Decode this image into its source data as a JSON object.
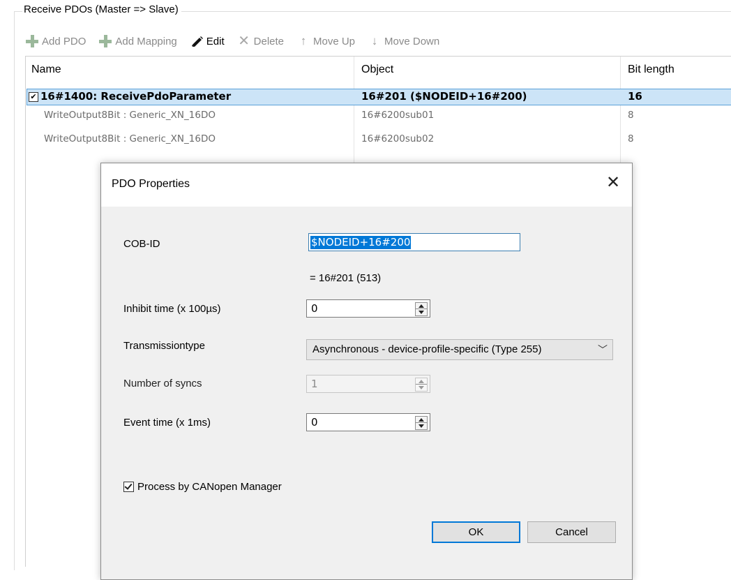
{
  "group": {
    "title": "Receive PDOs (Master => Slave)"
  },
  "toolbar": {
    "add_pdo": "Add PDO",
    "add_mapping": "Add Mapping",
    "edit": "Edit",
    "delete": "Delete",
    "move_up": "Move Up",
    "move_down": "Move Down"
  },
  "table": {
    "columns": [
      "Name",
      "Object",
      "Bit length"
    ],
    "rows": [
      {
        "checked": true,
        "name": "16#1400: ReceivePdoParameter",
        "object": "16#201 ($NODEID+16#200)",
        "bit_length": "16"
      },
      {
        "name": "WriteOutput8Bit : Generic_XN_16DO",
        "object": "16#6200sub01",
        "bit_length": "8"
      },
      {
        "name": "WriteOutput8Bit : Generic_XN_16DO",
        "object": "16#6200sub02",
        "bit_length": "8"
      }
    ]
  },
  "dialog": {
    "title": "PDO Properties",
    "cob_id_label": "COB-ID",
    "cob_id_value": "$NODEID+16#200",
    "cob_id_computed": "= 16#201 (513)",
    "inhibit_label": "Inhibit time (x 100µs)",
    "inhibit_value": "0",
    "transmission_label": "Transmissiontype",
    "transmission_value": "Asynchronous - device-profile-specific (Type 255)",
    "syncs_label": "Number of syncs",
    "syncs_value": "1",
    "event_label": "Event time (x 1ms)",
    "event_value": "0",
    "process_label": "Process by CANopen Manager",
    "process_checked": true,
    "ok_label": "OK",
    "cancel_label": "Cancel"
  },
  "icons": {
    "add": "plus-icon",
    "edit": "pencil-icon",
    "delete": "x-icon",
    "move_up": "arrow-up-icon",
    "move_down": "arrow-down-icon",
    "close": "close-icon"
  },
  "colors": {
    "selection_bg": "#cce4f7",
    "selection_border": "#5aa0d8",
    "text_selection": "#0078d7",
    "default_button_border": "#0078d7"
  }
}
